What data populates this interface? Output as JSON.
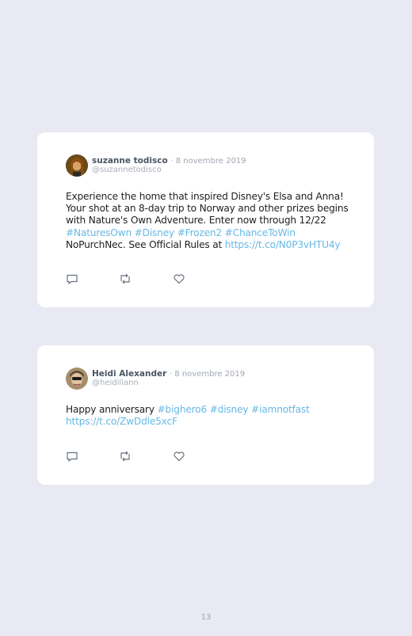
{
  "tweets": [
    {
      "author": "suzanne todisco",
      "date": "· 8 novembre 2019",
      "handle": "@suzannetodisco",
      "lines": [
        {
          "segments": [
            {
              "text": "Experience the home that inspired Disney's Elsa and Anna!",
              "link": false
            }
          ]
        },
        {
          "segments": [
            {
              "text": "Your shot at an 8-day trip to Norway and other prizes begins",
              "link": false
            }
          ]
        },
        {
          "segments": [
            {
              "text": "with Nature's Own Adventure. Enter now through 12/22",
              "link": false
            }
          ]
        },
        {
          "segments": [
            {
              "text": "#NaturesOwn #Disney #Frozen2 #ChanceToWin",
              "link": true
            }
          ]
        },
        {
          "segments": [
            {
              "text": "NoPurchNec. See Official Rules at ",
              "link": false
            },
            {
              "text": "https://t.co/N0P3vHTU4y",
              "link": true
            }
          ]
        }
      ]
    },
    {
      "author": "Heidi Alexander",
      "date": "· 8 novembre 2019",
      "handle": "@heidiliann",
      "lines": [
        {
          "segments": [
            {
              "text": "Happy anniversary ",
              "link": false
            },
            {
              "text": "#bighero6 #disney #iamnotfast",
              "link": true
            }
          ]
        },
        {
          "segments": [
            {
              "text": "https://t.co/ZwDdle5xcF",
              "link": true
            }
          ]
        }
      ]
    }
  ],
  "icons": [
    "reply-icon",
    "retweet-icon",
    "like-icon"
  ],
  "colors": {
    "link": "#67b8e3",
    "background": "#e9e9f3",
    "card": "#ffffff"
  },
  "page_number": "13"
}
